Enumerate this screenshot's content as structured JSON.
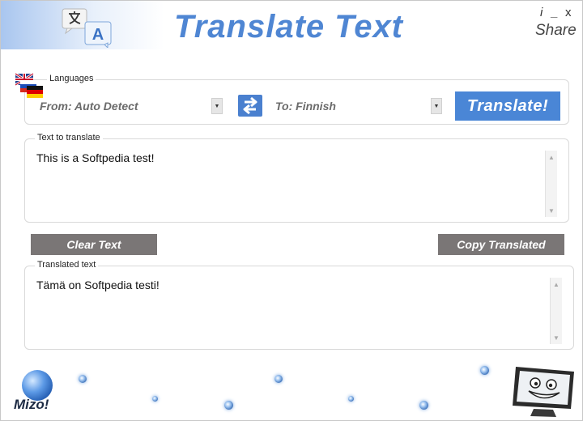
{
  "header": {
    "title": "Translate Text",
    "info_label": "i",
    "minimize_label": "_",
    "close_label": "x",
    "share_label": "Share",
    "logo_icon": "translate-logo-icon"
  },
  "languages": {
    "group_label": "Languages",
    "from_value": "From: Auto Detect",
    "to_value": "To: Finnish",
    "dropdown_glyph": "▼",
    "translate_label": "Translate!"
  },
  "source": {
    "group_label": "Text to translate",
    "text": "This is a Softpedia test!"
  },
  "actions": {
    "clear_label": "Clear Text",
    "copy_label": "Copy Translated"
  },
  "output": {
    "group_label": "Translated text",
    "text": "Tämä on Softpedia testi!"
  },
  "footer": {
    "brand": "Mizo!"
  },
  "scroll_arrows": {
    "up": "▲",
    "down": "▼"
  },
  "colors": {
    "accent": "#4a86d6",
    "title": "#4f86d3",
    "action_button": "#7a7676"
  }
}
